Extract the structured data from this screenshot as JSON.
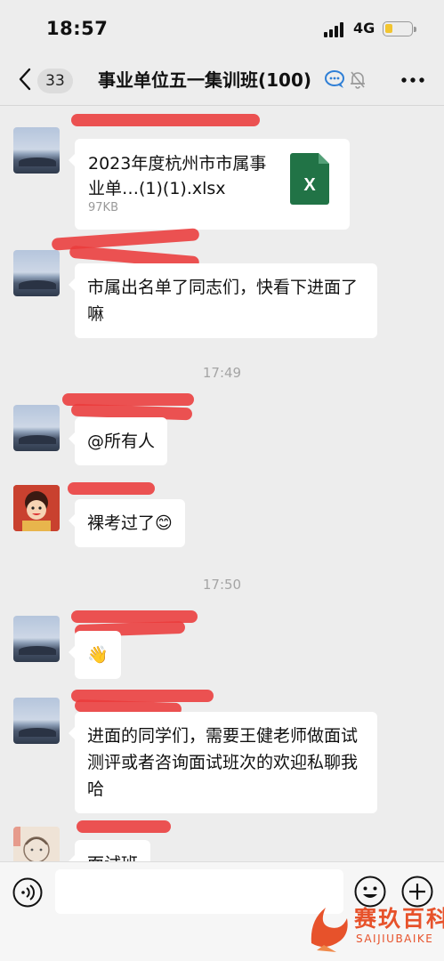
{
  "status_bar": {
    "time": "18:57",
    "network": "4G",
    "battery_level": 0.3
  },
  "nav": {
    "back_icon": "chevron-left-icon",
    "unread_count": "33",
    "title": "事业单位五一集训班(100)",
    "icons": [
      "chat-bubble-icon",
      "mute-bell-icon",
      "more-icon"
    ]
  },
  "messages": [
    {
      "type": "file",
      "file_name": "2023年度杭州市市属事业单…(1)(1).xlsx",
      "file_size": "97KB",
      "file_icon": "excel-icon"
    },
    {
      "type": "text",
      "text": "市属出名单了同志们，快看下进面了嘛"
    },
    {
      "type": "timestamp",
      "text": "17:49"
    },
    {
      "type": "text",
      "text": "@所有人"
    },
    {
      "type": "text",
      "text": "裸考过了😊"
    },
    {
      "type": "timestamp",
      "text": "17:50"
    },
    {
      "type": "text",
      "text": "👋"
    },
    {
      "type": "text",
      "text": "进面的同学们，需要王健老师做面试测评或者咨询面试班次的欢迎私聊我哈"
    },
    {
      "type": "text",
      "text": "面试班"
    }
  ],
  "input_bar": {
    "placeholder": "",
    "icons": [
      "voice-icon",
      "emoji-icon",
      "plus-icon"
    ]
  },
  "watermark": {
    "title": "赛玖百科",
    "subtitle": "SAIJIUBAIKE"
  },
  "colors": {
    "background": "#ededed",
    "bubble": "#ffffff",
    "excel_green": "#217346",
    "name_redaction": "#ea3b3b",
    "watermark": "#e7522b"
  }
}
